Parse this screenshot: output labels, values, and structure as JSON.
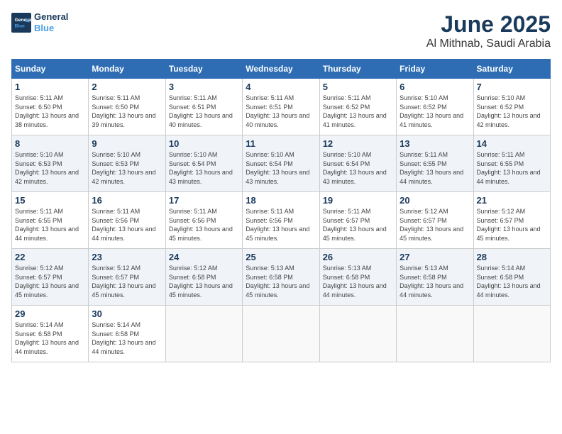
{
  "logo": {
    "line1": "General",
    "line2": "Blue"
  },
  "title": "June 2025",
  "location": "Al Mithnab, Saudi Arabia",
  "weekdays": [
    "Sunday",
    "Monday",
    "Tuesday",
    "Wednesday",
    "Thursday",
    "Friday",
    "Saturday"
  ],
  "weeks": [
    [
      {
        "day": "1",
        "rise": "5:11 AM",
        "set": "6:50 PM",
        "daylight": "13 hours and 38 minutes."
      },
      {
        "day": "2",
        "rise": "5:11 AM",
        "set": "6:50 PM",
        "daylight": "13 hours and 39 minutes."
      },
      {
        "day": "3",
        "rise": "5:11 AM",
        "set": "6:51 PM",
        "daylight": "13 hours and 40 minutes."
      },
      {
        "day": "4",
        "rise": "5:11 AM",
        "set": "6:51 PM",
        "daylight": "13 hours and 40 minutes."
      },
      {
        "day": "5",
        "rise": "5:11 AM",
        "set": "6:52 PM",
        "daylight": "13 hours and 41 minutes."
      },
      {
        "day": "6",
        "rise": "5:10 AM",
        "set": "6:52 PM",
        "daylight": "13 hours and 41 minutes."
      },
      {
        "day": "7",
        "rise": "5:10 AM",
        "set": "6:52 PM",
        "daylight": "13 hours and 42 minutes."
      }
    ],
    [
      {
        "day": "8",
        "rise": "5:10 AM",
        "set": "6:53 PM",
        "daylight": "13 hours and 42 minutes."
      },
      {
        "day": "9",
        "rise": "5:10 AM",
        "set": "6:53 PM",
        "daylight": "13 hours and 42 minutes."
      },
      {
        "day": "10",
        "rise": "5:10 AM",
        "set": "6:54 PM",
        "daylight": "13 hours and 43 minutes."
      },
      {
        "day": "11",
        "rise": "5:10 AM",
        "set": "6:54 PM",
        "daylight": "13 hours and 43 minutes."
      },
      {
        "day": "12",
        "rise": "5:10 AM",
        "set": "6:54 PM",
        "daylight": "13 hours and 43 minutes."
      },
      {
        "day": "13",
        "rise": "5:11 AM",
        "set": "6:55 PM",
        "daylight": "13 hours and 44 minutes."
      },
      {
        "day": "14",
        "rise": "5:11 AM",
        "set": "6:55 PM",
        "daylight": "13 hours and 44 minutes."
      }
    ],
    [
      {
        "day": "15",
        "rise": "5:11 AM",
        "set": "6:55 PM",
        "daylight": "13 hours and 44 minutes."
      },
      {
        "day": "16",
        "rise": "5:11 AM",
        "set": "6:56 PM",
        "daylight": "13 hours and 44 minutes."
      },
      {
        "day": "17",
        "rise": "5:11 AM",
        "set": "6:56 PM",
        "daylight": "13 hours and 45 minutes."
      },
      {
        "day": "18",
        "rise": "5:11 AM",
        "set": "6:56 PM",
        "daylight": "13 hours and 45 minutes."
      },
      {
        "day": "19",
        "rise": "5:11 AM",
        "set": "6:57 PM",
        "daylight": "13 hours and 45 minutes."
      },
      {
        "day": "20",
        "rise": "5:12 AM",
        "set": "6:57 PM",
        "daylight": "13 hours and 45 minutes."
      },
      {
        "day": "21",
        "rise": "5:12 AM",
        "set": "6:57 PM",
        "daylight": "13 hours and 45 minutes."
      }
    ],
    [
      {
        "day": "22",
        "rise": "5:12 AM",
        "set": "6:57 PM",
        "daylight": "13 hours and 45 minutes."
      },
      {
        "day": "23",
        "rise": "5:12 AM",
        "set": "6:57 PM",
        "daylight": "13 hours and 45 minutes."
      },
      {
        "day": "24",
        "rise": "5:12 AM",
        "set": "6:58 PM",
        "daylight": "13 hours and 45 minutes."
      },
      {
        "day": "25",
        "rise": "5:13 AM",
        "set": "6:58 PM",
        "daylight": "13 hours and 45 minutes."
      },
      {
        "day": "26",
        "rise": "5:13 AM",
        "set": "6:58 PM",
        "daylight": "13 hours and 44 minutes."
      },
      {
        "day": "27",
        "rise": "5:13 AM",
        "set": "6:58 PM",
        "daylight": "13 hours and 44 minutes."
      },
      {
        "day": "28",
        "rise": "5:14 AM",
        "set": "6:58 PM",
        "daylight": "13 hours and 44 minutes."
      }
    ],
    [
      {
        "day": "29",
        "rise": "5:14 AM",
        "set": "6:58 PM",
        "daylight": "13 hours and 44 minutes."
      },
      {
        "day": "30",
        "rise": "5:14 AM",
        "set": "6:58 PM",
        "daylight": "13 hours and 44 minutes."
      },
      null,
      null,
      null,
      null,
      null
    ]
  ]
}
